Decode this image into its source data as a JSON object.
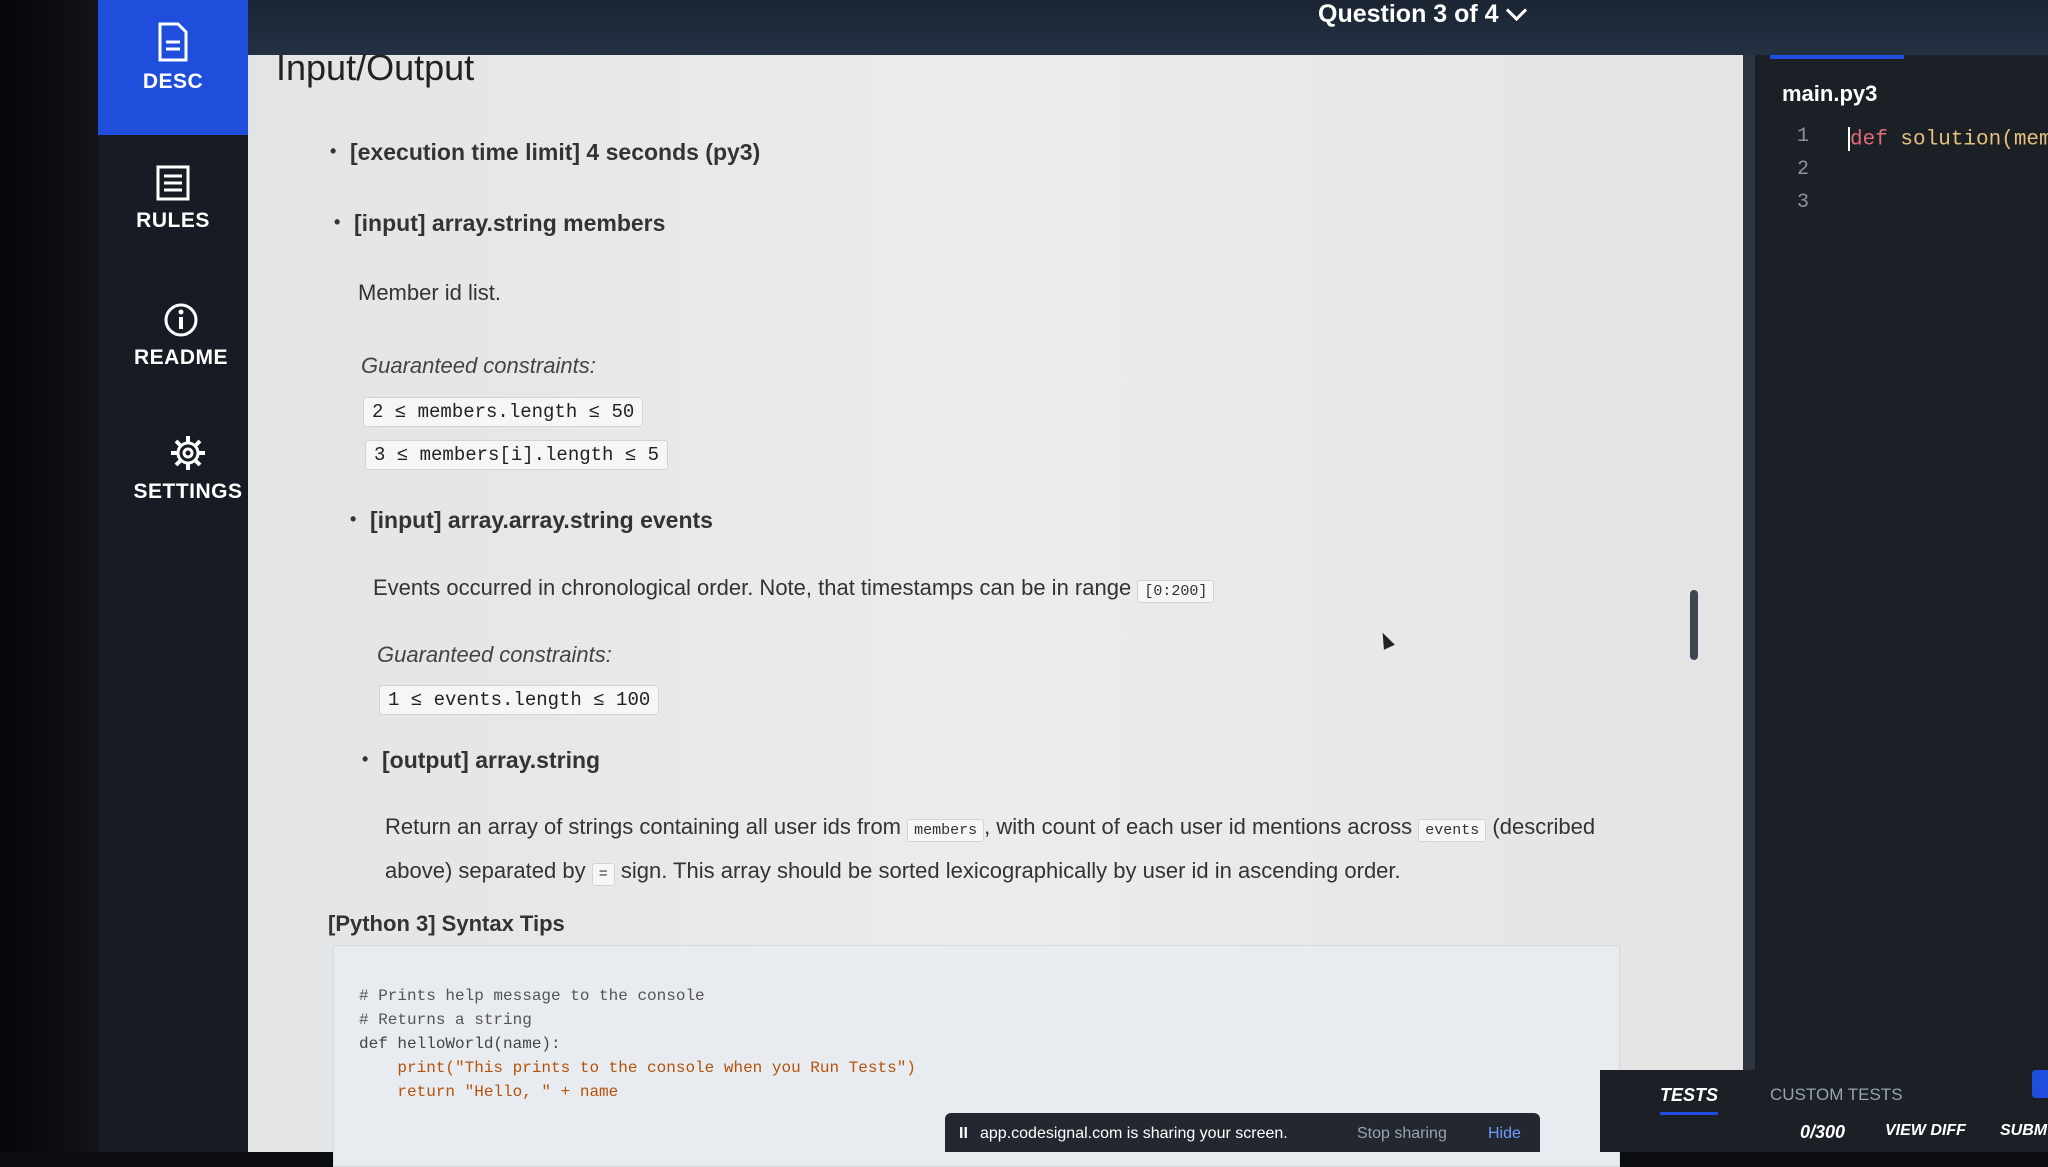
{
  "header": {
    "question": "Question 3 of 4"
  },
  "sidebar": {
    "items": [
      {
        "label": "DESC"
      },
      {
        "label": "RULES"
      },
      {
        "label": "README"
      },
      {
        "label": "SETTINGS"
      }
    ]
  },
  "description": {
    "title": "Input/Output",
    "time_limit": "[execution time limit] 4 seconds (py3)",
    "input1": {
      "label": "[input] array.string members",
      "desc": "Member id list.",
      "constraints_label": "Guaranteed constraints:",
      "c1": "2 ≤ members.length ≤ 50",
      "c2": "3 ≤ members[i].length ≤ 5"
    },
    "input2": {
      "label": "[input] array.array.string events",
      "desc": "Events occurred in chronological order. Note, that timestamps can be in range",
      "range": "[0:200]",
      "constraints_label": "Guaranteed constraints:",
      "c1": "1 ≤ events.length ≤ 100"
    },
    "output": {
      "label": "[output] array.string",
      "p1": "Return an array of strings containing all user ids from",
      "code1": "members",
      "p2": ", with count of each user id mentions across",
      "code2": "events",
      "p3": "(described",
      "p4": "above) separated by",
      "code3": "=",
      "p5": "sign. This array should be sorted lexicographically by user id in ascending order."
    },
    "tips_heading": "[Python 3] Syntax Tips",
    "code_lines": [
      "# Prints help message to the console",
      "# Returns a string",
      "def helloWorld(name):",
      "    print(\"This prints to the console when you Run Tests\")",
      "    return \"Hello, \" + name"
    ]
  },
  "editor": {
    "file_name": "main.py3",
    "line_numbers": [
      "1",
      "2",
      "3"
    ],
    "code_kw": "def",
    "code_rest": " solution(memb"
  },
  "tests": {
    "tab_tests": "TESTS",
    "tab_custom": "CUSTOM TESTS",
    "score": "0/300",
    "view_diff": "VIEW DIFF",
    "submit": "SUBM"
  },
  "share_bar": {
    "pause": "II",
    "message": "app.codesignal.com is sharing your screen.",
    "stop": "Stop sharing",
    "hide": "Hide"
  }
}
